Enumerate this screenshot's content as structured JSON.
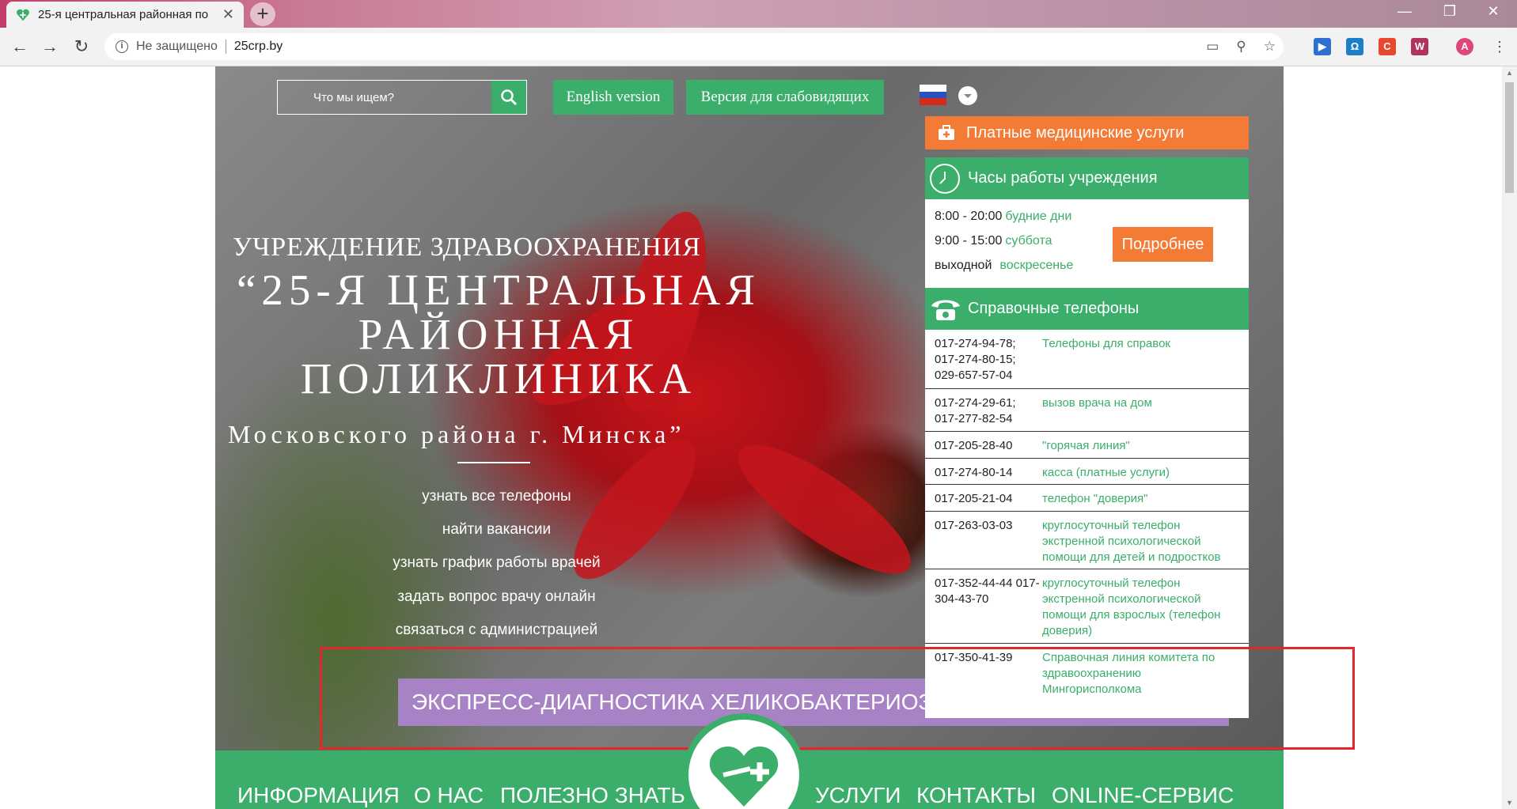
{
  "browser": {
    "tab_title": "25-я центральная районная по",
    "tab_close": "✕",
    "new_tab": "+",
    "security_label": "Не защищено",
    "url": "25crp.by",
    "profile_initial": "А"
  },
  "header": {
    "search_placeholder": "Что мы ищем?",
    "english_btn": "English version",
    "low_vision_btn": "Версия для слабовидящих"
  },
  "hero": {
    "org_type": "УЧРЕЖДЕНИЕ ЗДРАВООХРАНЕНИЯ",
    "org_name_1": "“25-Я ЦЕНТРАЛЬНАЯ",
    "org_name_2": "РАЙОННАЯ",
    "org_name_3": "ПОЛИКЛИНИКА",
    "org_city": "Московского района г. Минска”",
    "links": [
      "узнать все телефоны",
      "найти вакансии",
      "узнать график работы врачей",
      "задать вопрос врачу онлайн",
      "связаться с администрацией"
    ]
  },
  "side": {
    "paid_services": "Платные медицинские услуги",
    "hours_title": "Часы работы учреждения",
    "hours": [
      {
        "time": "8:00 - 20:00",
        "day": "будние дни"
      },
      {
        "time": "9:00 - 15:00",
        "day": "суббота"
      },
      {
        "time": "выходной",
        "day": "воскресенье"
      }
    ],
    "more_btn": "Подробнее",
    "phones_title": "Справочные телефоны",
    "phones": [
      {
        "num": "017-274-94-78; 017-274-80-15; 029-657-57-04",
        "desc": "Телефоны для справок"
      },
      {
        "num": "017-274-29-61; 017-277-82-54",
        "desc": "вызов врача на дом"
      },
      {
        "num": "017-205-28-40",
        "desc": "\"горячая линия\""
      },
      {
        "num": "017-274-80-14",
        "desc": "касса (платные услуги)"
      },
      {
        "num": "017-205-21-04",
        "desc": "телефон \"доверия\""
      },
      {
        "num": "017-263-03-03",
        "desc": "круглосуточный телефон экстренной психологической помощи для детей и подростков"
      },
      {
        "num": "017-352-44-44 017-304-43-70",
        "desc": "круглосуточный телефон экстренной психологической помощи для взрослых (телефон доверия)"
      },
      {
        "num": "017-350-41-39",
        "desc": "Справочная линия комитета по здравоохранению Мингорисполкома"
      }
    ]
  },
  "banner": {
    "text": "ЭКСПРЕСС-ДИАГНОСТИКА ХЕЛИКОБАКТЕРИОЗА"
  },
  "nav": {
    "info": "ИНФОРМАЦИЯ",
    "about": "О НАС",
    "useful": "ПОЛЕЗНО ЗНАТЬ",
    "services": "УСЛУГИ",
    "contacts": "КОНТАКТЫ",
    "online": "ONLINE-СЕРВИС"
  },
  "colors": {
    "green": "#3aae6a",
    "orange": "#f47b35",
    "purple": "#a783c6",
    "highlight": "#e5272d"
  }
}
